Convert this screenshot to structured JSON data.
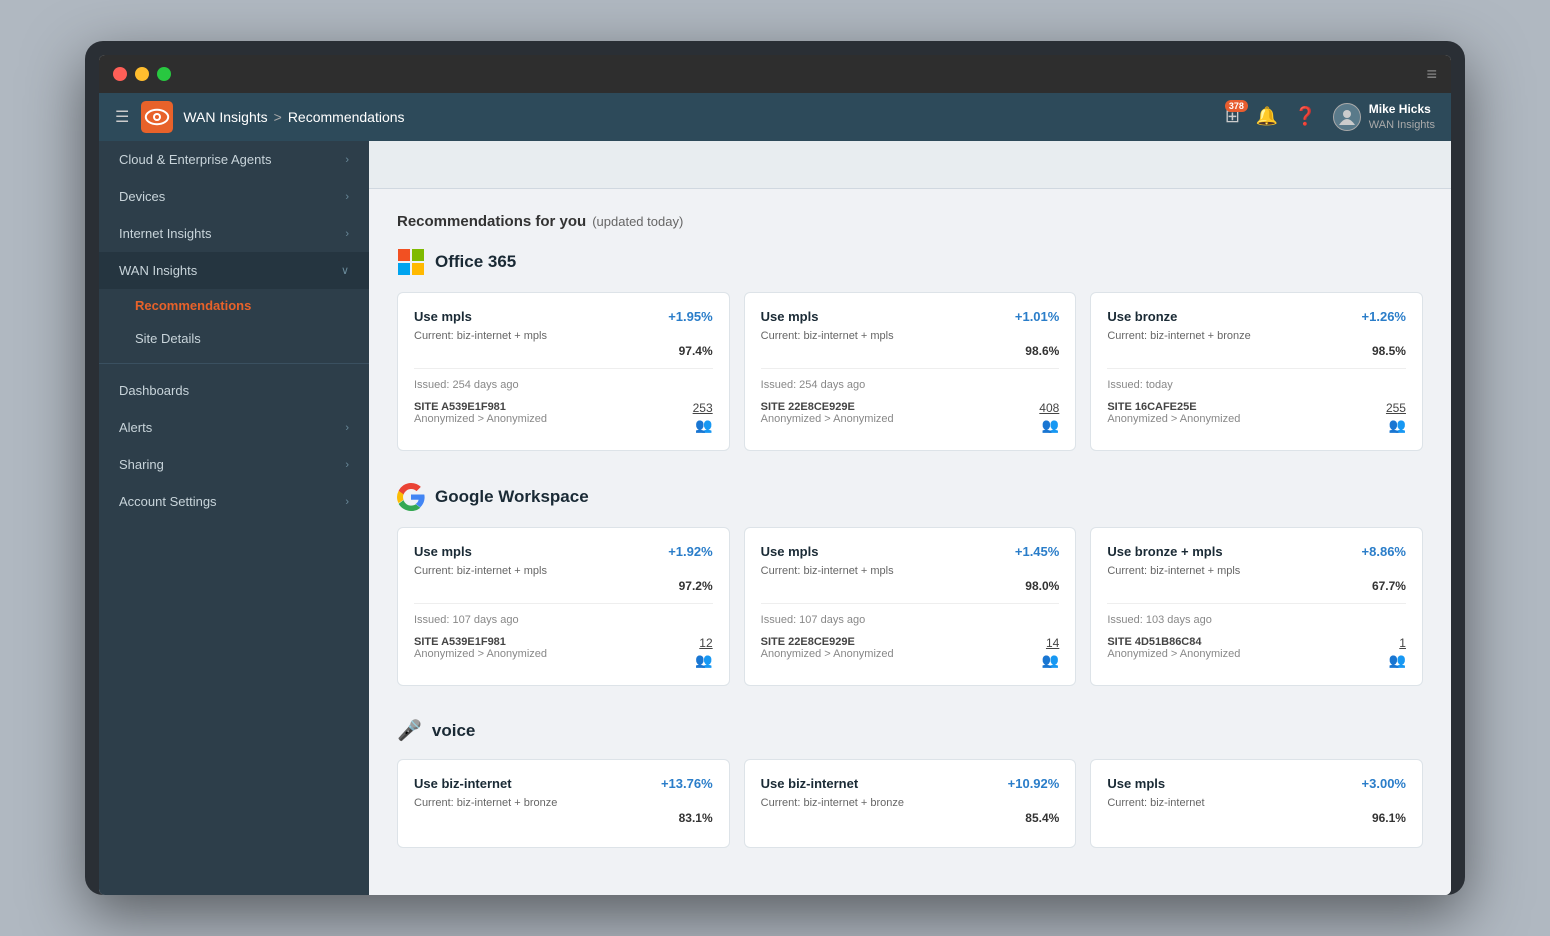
{
  "window": {
    "title": "WAN Insights"
  },
  "titlebar": {
    "menu_icon": "≡"
  },
  "topnav": {
    "hamburger": "☰",
    "breadcrumb_parent": "WAN Insights",
    "separator": ">",
    "breadcrumb_current": "Recommendations",
    "badge_count": "378",
    "user_name": "Mike Hicks",
    "user_sub": "WAN Insights"
  },
  "sidebar": {
    "items": [
      {
        "label": "Cloud & Enterprise Agents",
        "has_chevron": true,
        "active": false
      },
      {
        "label": "Devices",
        "has_chevron": true,
        "active": false
      },
      {
        "label": "Internet Insights",
        "has_chevron": true,
        "active": false
      },
      {
        "label": "WAN Insights",
        "has_chevron": true,
        "expanded": true,
        "active": true
      }
    ],
    "sub_items": [
      {
        "label": "Recommendations",
        "active": true
      },
      {
        "label": "Site Details",
        "active": false
      }
    ],
    "bottom_items": [
      {
        "label": "Dashboards",
        "has_chevron": false
      },
      {
        "label": "Alerts",
        "has_chevron": true
      },
      {
        "label": "Sharing",
        "has_chevron": true
      },
      {
        "label": "Account Settings",
        "has_chevron": true
      }
    ]
  },
  "content": {
    "section_title": "Recommendations for you",
    "section_updated": "(updated today)",
    "apps": [
      {
        "name": "Office 365",
        "icon_type": "office365",
        "cards": [
          {
            "recommendation": "Use mpls",
            "improvement": "+1.95%",
            "current": "Current: biz-internet + mpls",
            "score": "97.4%",
            "issued": "Issued: 254 days ago",
            "site": "SITE A539E1F981",
            "route": "Anonymized > Anonymized",
            "count": "253"
          },
          {
            "recommendation": "Use mpls",
            "improvement": "+1.01%",
            "current": "Current: biz-internet + mpls",
            "score": "98.6%",
            "issued": "Issued: 254 days ago",
            "site": "SITE 22E8CE929E",
            "route": "Anonymized > Anonymized",
            "count": "408"
          },
          {
            "recommendation": "Use bronze",
            "improvement": "+1.26%",
            "current": "Current: biz-internet + bronze",
            "score": "98.5%",
            "issued": "Issued: today",
            "site": "SITE 16CAFE25E",
            "route": "Anonymized > Anonymized",
            "count": "255"
          }
        ]
      },
      {
        "name": "Google Workspace",
        "icon_type": "google",
        "cards": [
          {
            "recommendation": "Use mpls",
            "improvement": "+1.92%",
            "current": "Current: biz-internet + mpls",
            "score": "97.2%",
            "issued": "Issued: 107 days ago",
            "site": "SITE A539E1F981",
            "route": "Anonymized > Anonymized",
            "count": "12"
          },
          {
            "recommendation": "Use mpls",
            "improvement": "+1.45%",
            "current": "Current: biz-internet + mpls",
            "score": "98.0%",
            "issued": "Issued: 107 days ago",
            "site": "SITE 22E8CE929E",
            "route": "Anonymized > Anonymized",
            "count": "14"
          },
          {
            "recommendation": "Use bronze + mpls",
            "improvement": "+8.86%",
            "current": "Current: biz-internet + mpls",
            "score": "67.7%",
            "issued": "Issued: 103 days ago",
            "site": "SITE 4D51B86C84",
            "route": "Anonymized > Anonymized",
            "count": "1"
          }
        ]
      },
      {
        "name": "voice",
        "icon_type": "voice",
        "cards": [
          {
            "recommendation": "Use biz-internet",
            "improvement": "+13.76%",
            "current": "Current: biz-internet + bronze",
            "score": "83.1%",
            "issued": "",
            "site": "",
            "route": "",
            "count": ""
          },
          {
            "recommendation": "Use biz-internet",
            "improvement": "+10.92%",
            "current": "Current: biz-internet + bronze",
            "score": "85.4%",
            "issued": "",
            "site": "",
            "route": "",
            "count": ""
          },
          {
            "recommendation": "Use mpls",
            "improvement": "+3.00%",
            "current": "Current: biz-internet",
            "score": "96.1%",
            "issued": "",
            "site": "",
            "route": "",
            "count": ""
          }
        ]
      }
    ]
  }
}
